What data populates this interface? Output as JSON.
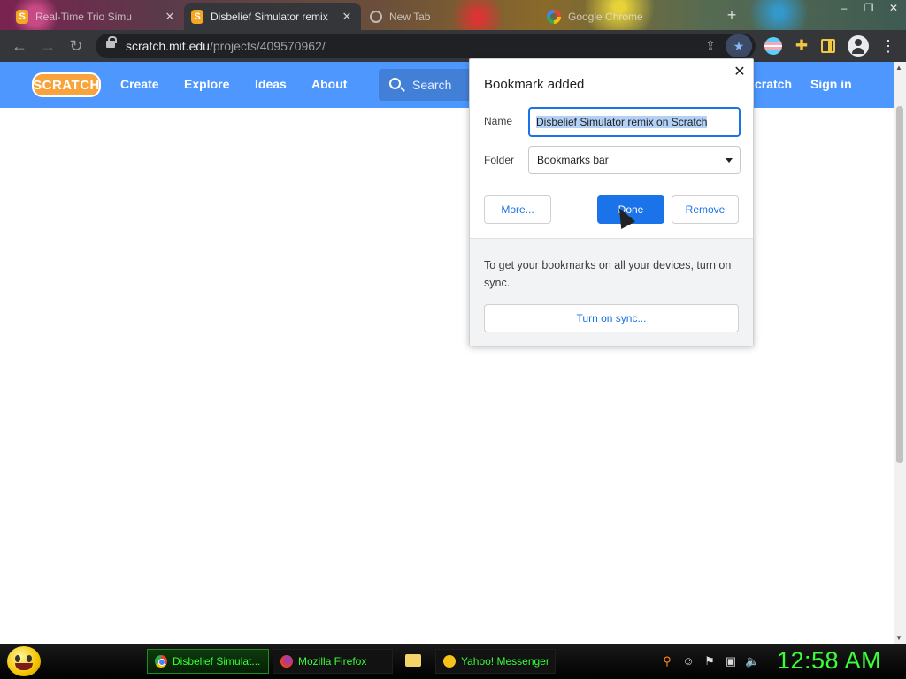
{
  "browser": {
    "tabs": [
      {
        "title": "Real-Time Trio Simu",
        "active": false
      },
      {
        "title": "Disbelief Simulator remix",
        "active": true
      },
      {
        "title": "New Tab",
        "active": false
      },
      {
        "title": "Google Chrome",
        "active": false
      }
    ],
    "url_host": "scratch.mit.edu",
    "url_path": "/projects/409570962/",
    "icons": {
      "back": "arrow-left-icon",
      "forward": "arrow-right-icon",
      "reload": "reload-icon",
      "bookmark": "star-icon",
      "menu": "kebab-menu-icon"
    }
  },
  "scratch_nav": {
    "logo": "SCRATCH",
    "links": [
      "Create",
      "Explore",
      "Ideas",
      "About"
    ],
    "search_placeholder": "Search",
    "right_link_partial": "cratch",
    "sign_in": "Sign in",
    "color": "#4d97ff"
  },
  "bookmark_bubble": {
    "title": "Bookmark added",
    "name_label": "Name",
    "name_value": "Disbelief Simulator remix on Scratch",
    "folder_label": "Folder",
    "folder_value": "Bookmarks bar",
    "more_button": "More...",
    "done_button": "Done",
    "remove_button": "Remove",
    "sync_text": "To get your bookmarks on all your devices, turn on sync.",
    "sync_button": "Turn on sync..."
  },
  "taskbar": {
    "items": [
      {
        "label": "Disbelief Simulat...",
        "icon": "chrome-icon",
        "active": true
      },
      {
        "label": "Mozilla Firefox",
        "icon": "firefox-icon",
        "active": false
      },
      {
        "label": "Yahoo! Messenger",
        "icon": "yahoo-messenger-icon",
        "active": false
      }
    ],
    "clock": "12:58 AM",
    "accent": "#39ff39"
  }
}
